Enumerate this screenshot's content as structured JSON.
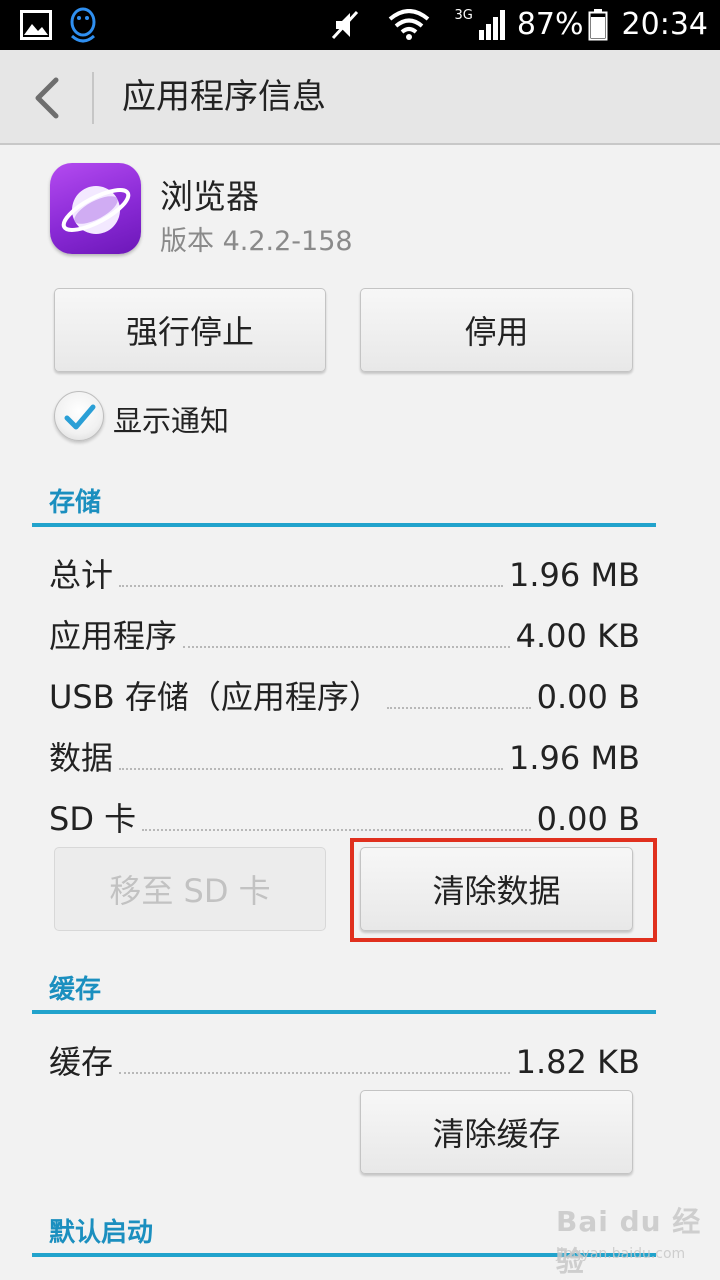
{
  "status_bar": {
    "battery": "87%",
    "time": "20:34",
    "network": "3G",
    "icons": [
      "picture-icon",
      "qq-icon",
      "mute-icon",
      "wifi-icon",
      "signal-icon",
      "battery-icon"
    ]
  },
  "header": {
    "title": "应用程序信息",
    "back_icon": "chevron-left-icon"
  },
  "app": {
    "name": "浏览器",
    "version": "版本 4.2.2-158",
    "icon": "browser-planet-icon"
  },
  "actions": {
    "force_stop": "强行停止",
    "disable": "停用"
  },
  "notification": {
    "label": "显示通知",
    "checked": true
  },
  "storage": {
    "title": "存储",
    "rows": [
      {
        "label": "总计",
        "value": "1.96 MB"
      },
      {
        "label": "应用程序",
        "value": "4.00 KB"
      },
      {
        "label": "USB 存储（应用程序）",
        "value": "0.00 B"
      },
      {
        "label": "数据",
        "value": "1.96 MB"
      },
      {
        "label": "SD 卡",
        "value": "0.00 B"
      }
    ],
    "move_to_sd": "移至 SD 卡",
    "clear_data": "清除数据"
  },
  "cache": {
    "title": "缓存",
    "rows": [
      {
        "label": "缓存",
        "value": "1.82 KB"
      }
    ],
    "clear_cache": "清除缓存"
  },
  "default_launch": {
    "title": "默认启动"
  },
  "colors": {
    "accent": "#22a3cc",
    "highlight": "#e0301e",
    "app_icon": "#8a2ad6"
  },
  "watermark": {
    "text": "Bai du 经验",
    "sub": "jingyan.baidu.com"
  }
}
